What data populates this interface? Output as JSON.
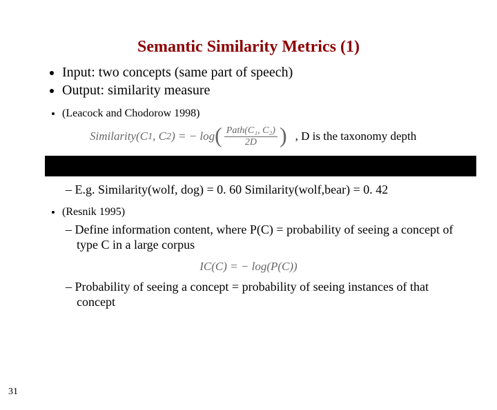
{
  "title": "Semantic Similarity Metrics (1)",
  "bullets": {
    "input": "Input: two concepts (same part of speech)",
    "output": "Output: similarity measure"
  },
  "leacock": {
    "ref": "(Leacock and Chodorow 1998)",
    "formula_lhs": "Similarity(C",
    "formula_sub1": "1",
    "formula_mid": ", C",
    "formula_sub2": "2",
    "formula_rhs_eq": ") = − log",
    "frac_num": "Path(C₁, C₂)",
    "frac_den": "2D",
    "note": ",  D is the taxonomy depth",
    "example": "E.g. Similarity(wolf, dog) = 0. 60   Similarity(wolf,bear) = 0. 42"
  },
  "resnik": {
    "ref": "(Resnik 1995)",
    "def": "Define information content, where P(C) = probability of seeing a concept of type C in a large corpus",
    "ic_formula": "IC(C) = − log(P(C))",
    "prob": "Probability of seeing a concept = probability of seeing instances of that concept"
  },
  "page": "31"
}
